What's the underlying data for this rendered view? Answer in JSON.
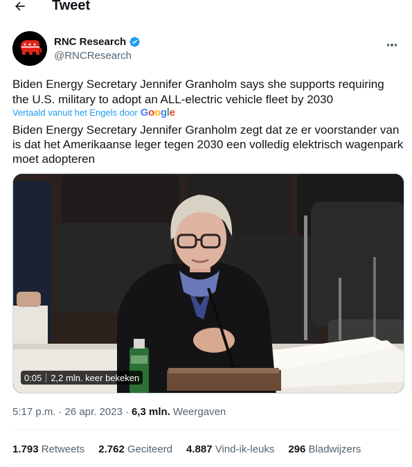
{
  "header": {
    "title": "Tweet"
  },
  "author": {
    "name": "RNC Research",
    "handle": "@RNCResearch"
  },
  "tweet": {
    "text": "Biden Energy Secretary Jennifer Granholm says she supports requiring the U.S. military to adopt an ALL-electric vehicle fleet by 2030",
    "translated_label": "Vertaald vanuit het Engels door",
    "translator": "Google",
    "translation": "Biden Energy Secretary Jennifer Granholm zegt dat ze er voorstander van is dat het Amerikaanse leger tegen 2030 een volledig elektrisch wagenpark moet adopteren"
  },
  "video": {
    "time": "0:05",
    "views": "2,2 mln. keer bekeken"
  },
  "meta": {
    "time": "5:17 p.m.",
    "date": "26 apr. 2023",
    "views_count": "6,3 mln.",
    "views_label": "Weergaven"
  },
  "stats": [
    {
      "num": "1.793",
      "label": "Retweets"
    },
    {
      "num": "2.762",
      "label": "Geciteerd"
    },
    {
      "num": "4.887",
      "label": "Vind-ik-leuks"
    },
    {
      "num": "296",
      "label": "Bladwijzers"
    }
  ],
  "colors": {
    "accent": "#1d9bf0",
    "verified": "#1d9bf0",
    "secondary_text": "#536471"
  }
}
